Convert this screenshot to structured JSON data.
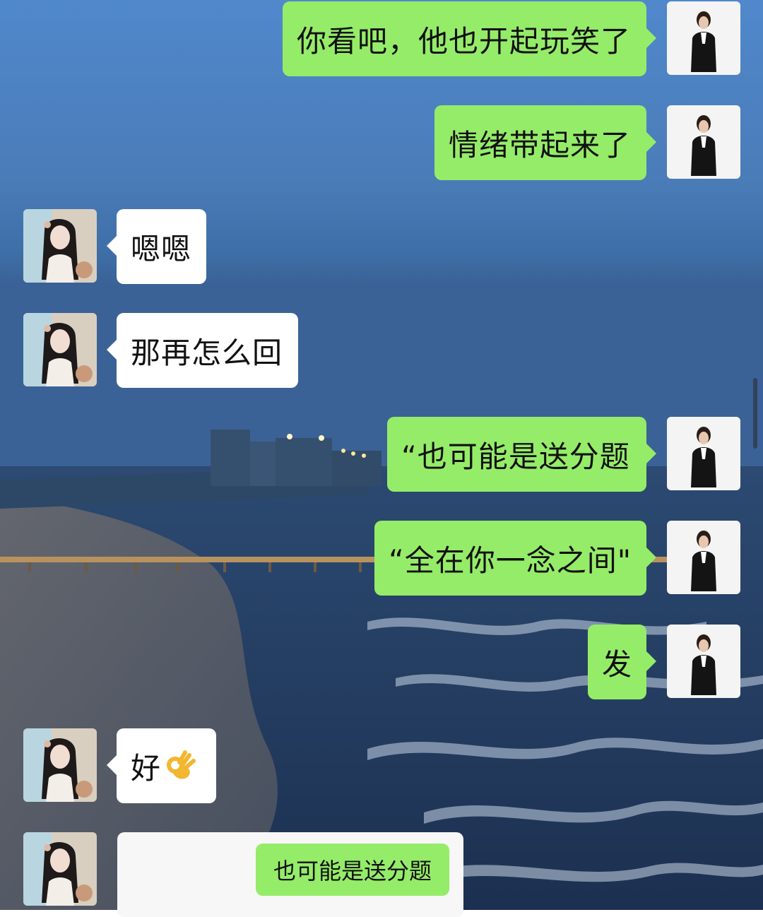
{
  "conversation": {
    "messages": [
      {
        "side": "right",
        "text": "你看吧，他也开起玩笑了"
      },
      {
        "side": "right",
        "text": "情绪带起来了"
      },
      {
        "side": "left",
        "text": "嗯嗯"
      },
      {
        "side": "left",
        "text": "那再怎么回"
      },
      {
        "side": "right",
        "text": "“也可能是送分题"
      },
      {
        "side": "right",
        "text": "“全在你一念之间\""
      },
      {
        "side": "right",
        "text": "发"
      },
      {
        "side": "left",
        "text": "好",
        "emoji": "ok-hand-emoji"
      },
      {
        "side": "left",
        "quote_text": "也可能是送分题"
      }
    ]
  },
  "colors": {
    "sent_bubble": "#95ec69",
    "received_bubble": "#ffffff",
    "sky_top": "#4d85c9",
    "sea": "#223a5c"
  },
  "icons": [
    "user-avatar-icon",
    "contact-avatar-icon",
    "ok-hand-emoji"
  ]
}
